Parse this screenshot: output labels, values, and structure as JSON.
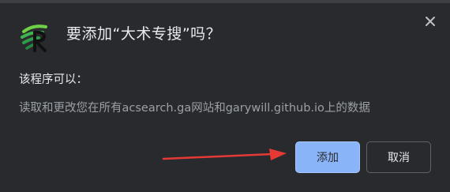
{
  "dialog": {
    "title": "要添加“大术专搜”吗？",
    "subheading": "该程序可以：",
    "permission": "读取和更改您在所有acsearch.ga网站和garywill.github.io上的数据",
    "buttons": {
      "add_label": "添加",
      "cancel_label": "取消"
    }
  },
  "colors": {
    "dialog_bg": "#292a2d",
    "primary_button": "#8ab4f8",
    "arrow": "#e53935",
    "icon_green": "#2e9d49"
  },
  "icons": {
    "extension": "extension-logo-icon",
    "close": "close-icon",
    "annotation": "red-arrow-annotation"
  }
}
